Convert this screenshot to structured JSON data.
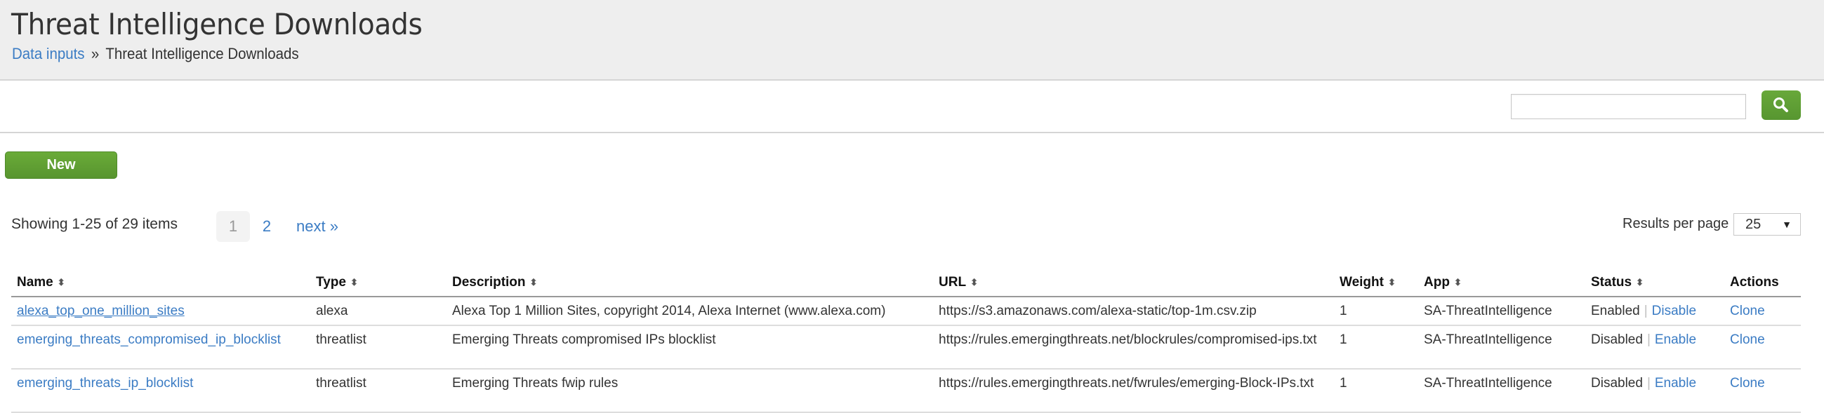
{
  "header": {
    "title": "Threat Intelligence Downloads",
    "breadcrumb": {
      "link_label": "Data inputs",
      "separator": "»",
      "current": "Threat Intelligence Downloads"
    }
  },
  "toolbar": {
    "search_value": "",
    "search_placeholder": "",
    "search_icon": "search-icon"
  },
  "actions": {
    "new_label": "New"
  },
  "pagination": {
    "showing": "Showing 1-25 of 29 items",
    "pages": [
      "1",
      "2"
    ],
    "current_page": "1",
    "next_label": "next »",
    "results_per_page_label": "Results per page",
    "results_per_page_value": "25"
  },
  "colors": {
    "accent_green": "#5e9e33",
    "link_blue": "#3b7cc4",
    "header_bg": "#eeeeee"
  },
  "table": {
    "columns": [
      {
        "label": "Name",
        "sortable": true
      },
      {
        "label": "Type",
        "sortable": true
      },
      {
        "label": "Description",
        "sortable": true
      },
      {
        "label": "URL",
        "sortable": true
      },
      {
        "label": "Weight",
        "sortable": true
      },
      {
        "label": "App",
        "sortable": true
      },
      {
        "label": "Status",
        "sortable": true
      },
      {
        "label": "Actions",
        "sortable": false
      }
    ],
    "rows": [
      {
        "name": "alexa_top_one_million_sites",
        "type": "alexa",
        "description": "Alexa Top 1 Million Sites, copyright 2014, Alexa Internet (www.alexa.com)",
        "url": "https://s3.amazonaws.com/alexa-static/top-1m.csv.zip",
        "weight": "1",
        "app": "SA-ThreatIntelligence",
        "status": "Enabled",
        "separator": "|",
        "toggle_action": "Disable",
        "clone_label": "Clone"
      },
      {
        "name": "emerging_threats_compromised_ip_blocklist",
        "type": "threatlist",
        "description": "Emerging Threats compromised IPs blocklist",
        "url": "https://rules.emergingthreats.net/blockrules/compromised-ips.txt",
        "weight": "1",
        "app": "SA-ThreatIntelligence",
        "status": "Disabled",
        "separator": "|",
        "toggle_action": "Enable",
        "clone_label": "Clone"
      },
      {
        "name": "emerging_threats_ip_blocklist",
        "type": "threatlist",
        "description": "Emerging Threats fwip rules",
        "url": "https://rules.emergingthreats.net/fwrules/emerging-Block-IPs.txt",
        "weight": "1",
        "app": "SA-ThreatIntelligence",
        "status": "Disabled",
        "separator": "|",
        "toggle_action": "Enable",
        "clone_label": "Clone"
      }
    ]
  }
}
